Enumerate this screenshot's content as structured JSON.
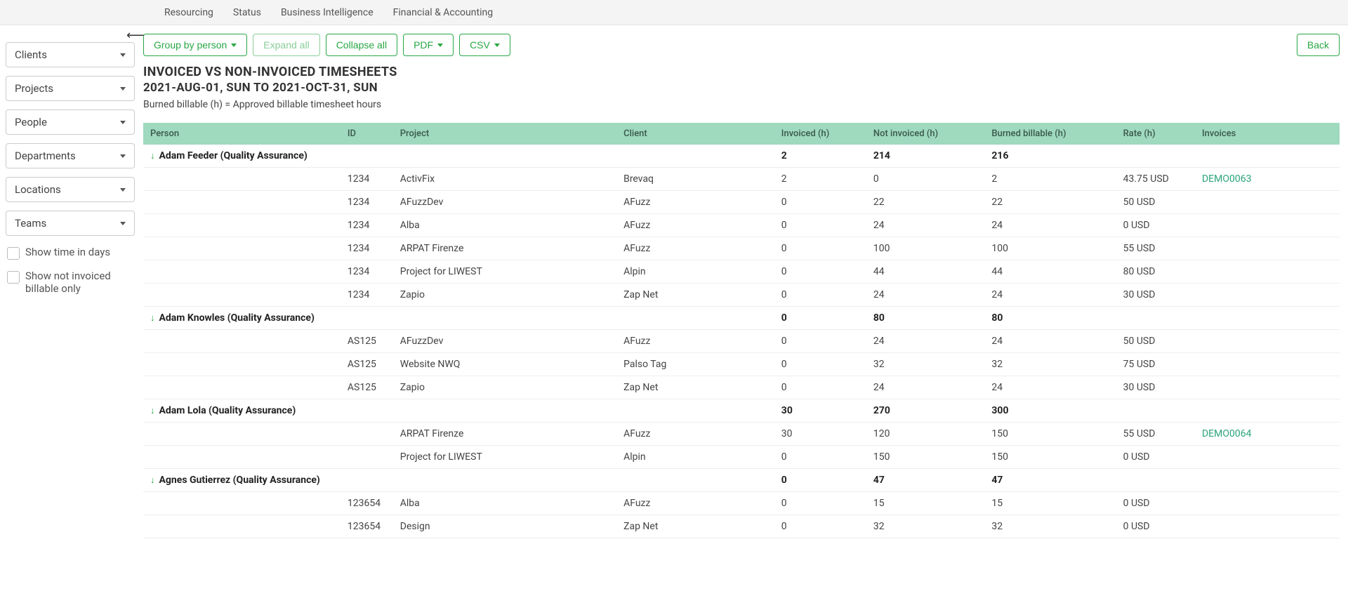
{
  "topnav": [
    "Resourcing",
    "Status",
    "Business Intelligence",
    "Financial & Accounting"
  ],
  "sidebar": {
    "filters": [
      "Clients",
      "Projects",
      "People",
      "Departments",
      "Locations",
      "Teams"
    ],
    "checkboxes": [
      "Show time in days",
      "Show not invoiced billable only"
    ]
  },
  "toolbar": {
    "group": "Group by person",
    "expand": "Expand all",
    "collapse": "Collapse all",
    "pdf": "PDF",
    "csv": "CSV",
    "back": "Back"
  },
  "heading": {
    "title": "INVOICED VS NON-INVOICED TIMESHEETS",
    "subtitle": "2021-AUG-01, SUN TO 2021-OCT-31, SUN",
    "note": "Burned billable (h) = Approved billable timesheet hours"
  },
  "columns": [
    "Person",
    "ID",
    "Project",
    "Client",
    "Invoiced (h)",
    "Not invoiced (h)",
    "Burned billable (h)",
    "Rate (h)",
    "Invoices"
  ],
  "groups": [
    {
      "person": "Adam Feeder (Quality Assurance)",
      "totals": {
        "invoiced": "2",
        "not_invoiced": "214",
        "burned": "216"
      },
      "rows": [
        {
          "id": "1234",
          "project": "ActivFix",
          "client": "Brevaq",
          "invoiced": "2",
          "not_invoiced": "0",
          "burned": "2",
          "rate": "43.75 USD",
          "invoice": "DEMO0063"
        },
        {
          "id": "1234",
          "project": "AFuzzDev",
          "client": "AFuzz",
          "invoiced": "0",
          "not_invoiced": "22",
          "burned": "22",
          "rate": "50 USD",
          "invoice": ""
        },
        {
          "id": "1234",
          "project": "Alba",
          "client": "AFuzz",
          "invoiced": "0",
          "not_invoiced": "24",
          "burned": "24",
          "rate": "0 USD",
          "invoice": ""
        },
        {
          "id": "1234",
          "project": "ARPAT Firenze",
          "client": "AFuzz",
          "invoiced": "0",
          "not_invoiced": "100",
          "burned": "100",
          "rate": "55 USD",
          "invoice": ""
        },
        {
          "id": "1234",
          "project": "Project for LIWEST",
          "client": "Alpin",
          "invoiced": "0",
          "not_invoiced": "44",
          "burned": "44",
          "rate": "80 USD",
          "invoice": ""
        },
        {
          "id": "1234",
          "project": "Zapio",
          "client": "Zap Net",
          "invoiced": "0",
          "not_invoiced": "24",
          "burned": "24",
          "rate": "30 USD",
          "invoice": ""
        }
      ]
    },
    {
      "person": "Adam Knowles (Quality Assurance)",
      "totals": {
        "invoiced": "0",
        "not_invoiced": "80",
        "burned": "80"
      },
      "rows": [
        {
          "id": "AS125",
          "project": "AFuzzDev",
          "client": "AFuzz",
          "invoiced": "0",
          "not_invoiced": "24",
          "burned": "24",
          "rate": "50 USD",
          "invoice": ""
        },
        {
          "id": "AS125",
          "project": "Website NWQ",
          "client": "Palso Tag",
          "invoiced": "0",
          "not_invoiced": "32",
          "burned": "32",
          "rate": "75 USD",
          "invoice": ""
        },
        {
          "id": "AS125",
          "project": "Zapio",
          "client": "Zap Net",
          "invoiced": "0",
          "not_invoiced": "24",
          "burned": "24",
          "rate": "30 USD",
          "invoice": ""
        }
      ]
    },
    {
      "person": "Adam Lola (Quality Assurance)",
      "totals": {
        "invoiced": "30",
        "not_invoiced": "270",
        "burned": "300"
      },
      "rows": [
        {
          "id": "",
          "project": "ARPAT Firenze",
          "client": "AFuzz",
          "invoiced": "30",
          "not_invoiced": "120",
          "burned": "150",
          "rate": "55 USD",
          "invoice": "DEMO0064"
        },
        {
          "id": "",
          "project": "Project for LIWEST",
          "client": "Alpin",
          "invoiced": "0",
          "not_invoiced": "150",
          "burned": "150",
          "rate": "0 USD",
          "invoice": ""
        }
      ]
    },
    {
      "person": "Agnes Gutierrez (Quality Assurance)",
      "totals": {
        "invoiced": "0",
        "not_invoiced": "47",
        "burned": "47"
      },
      "rows": [
        {
          "id": "123654",
          "project": "Alba",
          "client": "AFuzz",
          "invoiced": "0",
          "not_invoiced": "15",
          "burned": "15",
          "rate": "0 USD",
          "invoice": ""
        },
        {
          "id": "123654",
          "project": "Design",
          "client": "Zap Net",
          "invoiced": "0",
          "not_invoiced": "32",
          "burned": "32",
          "rate": "0 USD",
          "invoice": ""
        }
      ]
    }
  ]
}
